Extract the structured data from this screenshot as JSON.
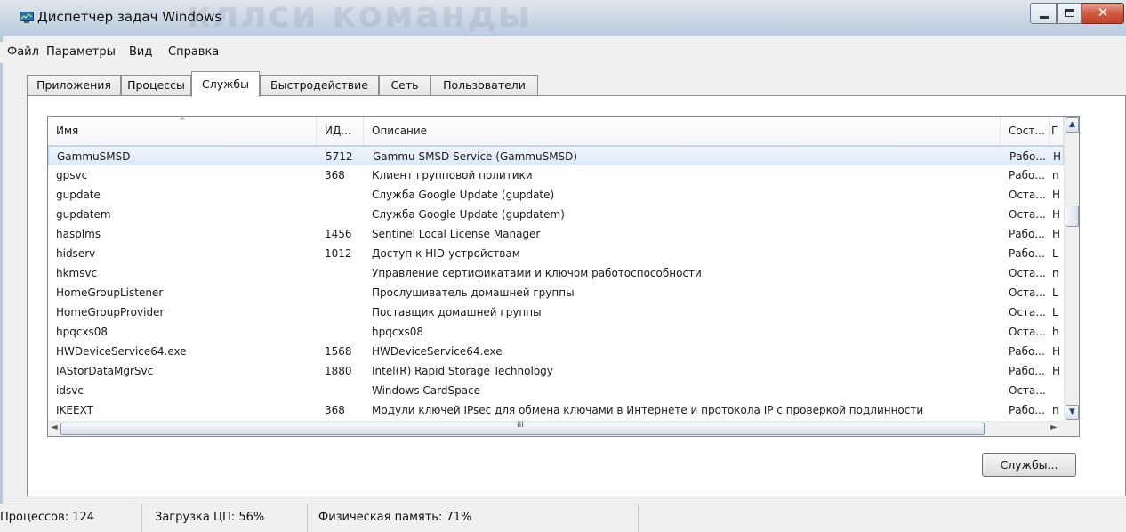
{
  "window": {
    "title": "Диспетчер задач Windows",
    "overlay_text": "кллси команды",
    "close_glyph": "✕"
  },
  "menu": [
    "Файл",
    "Параметры",
    "Вид",
    "Справка"
  ],
  "tabs": [
    {
      "label": "Приложения",
      "active": false
    },
    {
      "label": "Процессы",
      "active": false
    },
    {
      "label": "Службы",
      "active": true
    },
    {
      "label": "Быстродействие",
      "active": false
    },
    {
      "label": "Сеть",
      "active": false
    },
    {
      "label": "Пользователи",
      "active": false
    }
  ],
  "services_table": {
    "columns": [
      "Имя",
      "ИД...",
      "Описание",
      "Сост...",
      "Г"
    ],
    "sort_indicator": "^",
    "rows": [
      {
        "name": "GammuSMSD",
        "pid": "5712",
        "description": "Gammu SMSD Service (GammuSMSD)",
        "status": "Рабо...",
        "group": "H",
        "selected": true
      },
      {
        "name": "gpsvc",
        "pid": "368",
        "description": "Клиент групповой политики",
        "status": "Рабо...",
        "group": "n"
      },
      {
        "name": "gupdate",
        "pid": "",
        "description": "Служба Google Update (gupdate)",
        "status": "Оста...",
        "group": "H"
      },
      {
        "name": "gupdatem",
        "pid": "",
        "description": "Служба Google Update (gupdatem)",
        "status": "Оста...",
        "group": "H"
      },
      {
        "name": "hasplms",
        "pid": "1456",
        "description": "Sentinel Local License Manager",
        "status": "Рабо...",
        "group": "H"
      },
      {
        "name": "hidserv",
        "pid": "1012",
        "description": "Доступ к HID-устройствам",
        "status": "Рабо...",
        "group": "L"
      },
      {
        "name": "hkmsvc",
        "pid": "",
        "description": "Управление сертификатами и ключом работоспособности",
        "status": "Оста...",
        "group": "n"
      },
      {
        "name": "HomeGroupListener",
        "pid": "",
        "description": "Прослушиватель домашней группы",
        "status": "Оста...",
        "group": "L"
      },
      {
        "name": "HomeGroupProvider",
        "pid": "",
        "description": "Поставщик домашней группы",
        "status": "Оста...",
        "group": "L"
      },
      {
        "name": "hpqcxs08",
        "pid": "",
        "description": "hpqcxs08",
        "status": "Оста...",
        "group": "h"
      },
      {
        "name": "HWDeviceService64.exe",
        "pid": "1568",
        "description": "HWDeviceService64.exe",
        "status": "Рабо...",
        "group": "H"
      },
      {
        "name": "IAStorDataMgrSvc",
        "pid": "1880",
        "description": "Intel(R) Rapid Storage Technology",
        "status": "Рабо...",
        "group": "H"
      },
      {
        "name": "idsvc",
        "pid": "",
        "description": "Windows CardSpace",
        "status": "Оста...",
        "group": ""
      },
      {
        "name": "IKEEXT",
        "pid": "368",
        "description": "Модули ключей IPsec для обмена ключами в Интернете и протокола IP с проверкой подлинности",
        "status": "Рабо...",
        "group": "n"
      }
    ]
  },
  "scrollbar": {
    "up": "▲",
    "down": "▼",
    "left": "◄",
    "right": "►",
    "grip": "III"
  },
  "buttons": {
    "services": "Службы..."
  },
  "status": {
    "processes": "Процессов: 124",
    "cpu": "Загрузка ЦП: 56%",
    "memory": "Физическая память: 71%"
  }
}
